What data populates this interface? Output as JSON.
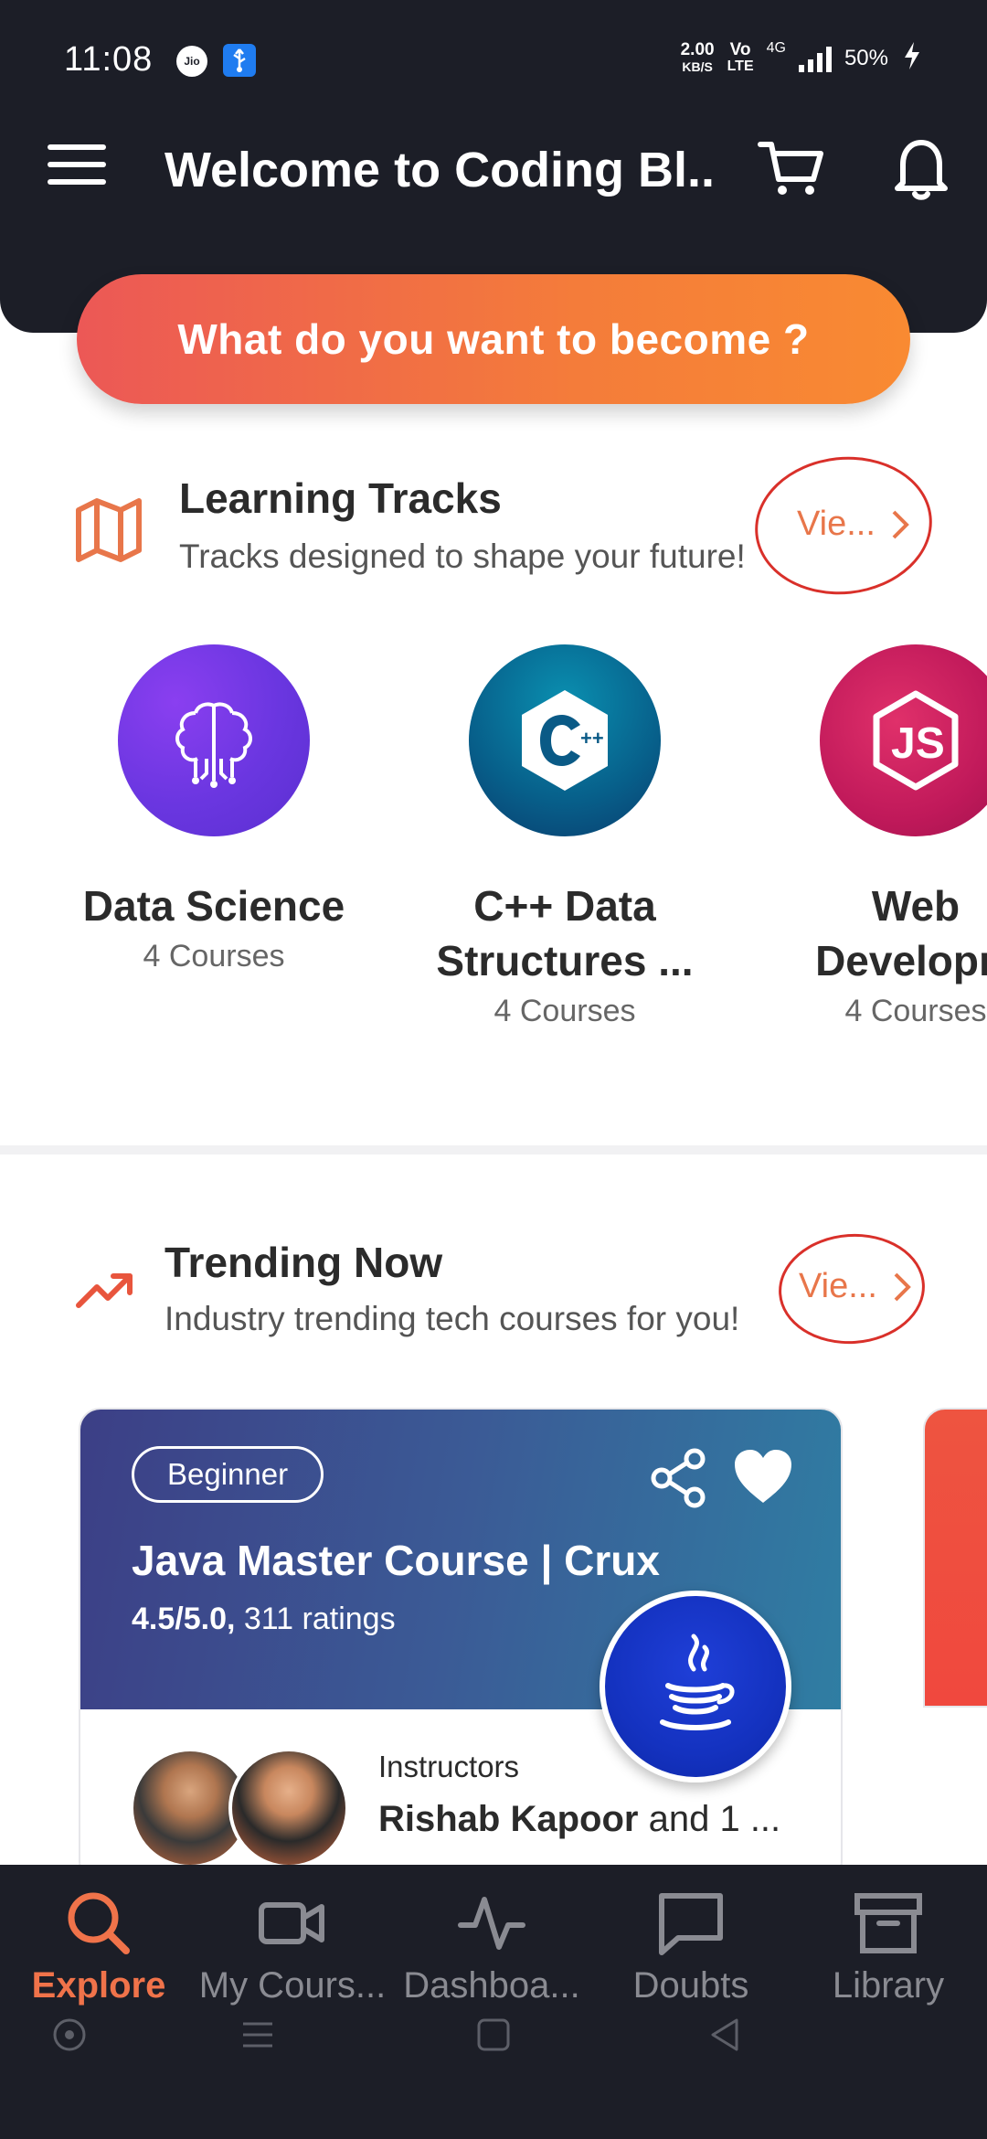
{
  "status_bar": {
    "time": "11:08",
    "carrier_badge": "Jio",
    "net_speed_value": "2.00",
    "net_speed_unit": "KB/S",
    "volte_top": "Vo",
    "volte_bottom": "LTE",
    "network": "4G",
    "battery": "50%"
  },
  "app_bar": {
    "title": "Welcome to Coding Bl..."
  },
  "hero": {
    "button_label": "What do you want to become ?"
  },
  "learning_tracks": {
    "title": "Learning Tracks",
    "subtitle": "Tracks designed to shape your future!",
    "view_all_label": "Vie...",
    "tracks": [
      {
        "name": "Data Science",
        "count": "4 Courses",
        "icon": "brain-circuit-icon"
      },
      {
        "name": "C++ Data Structures ...",
        "count": "4 Courses",
        "icon": "cpp-icon"
      },
      {
        "name": "Web Developm",
        "count": "4 Courses",
        "icon": "nodejs-icon"
      }
    ]
  },
  "trending": {
    "title": "Trending Now",
    "subtitle": "Industry trending tech courses for you!",
    "view_all_label": "Vie...",
    "course": {
      "level": "Beginner",
      "title": "Java Master Course | Crux",
      "rating_value": "4.5/5.0,",
      "rating_count": "311 ratings",
      "instructors_label": "Instructors",
      "instructor_primary": "Rishab Kapoor",
      "instructor_more": "and 1 ..."
    }
  },
  "bottom_nav": {
    "items": [
      {
        "label": "Explore",
        "icon": "search-icon",
        "active": true
      },
      {
        "label": "My Cours...",
        "icon": "video-camera-icon",
        "active": false
      },
      {
        "label": "Dashboa...",
        "icon": "activity-icon",
        "active": false
      },
      {
        "label": "Doubts",
        "icon": "chat-bubble-icon",
        "active": false
      },
      {
        "label": "Library",
        "icon": "archive-box-icon",
        "active": false
      }
    ]
  },
  "colors": {
    "accent": "#f0734a",
    "header_bg": "#1c1e27",
    "annotation_red": "#d9302a"
  }
}
